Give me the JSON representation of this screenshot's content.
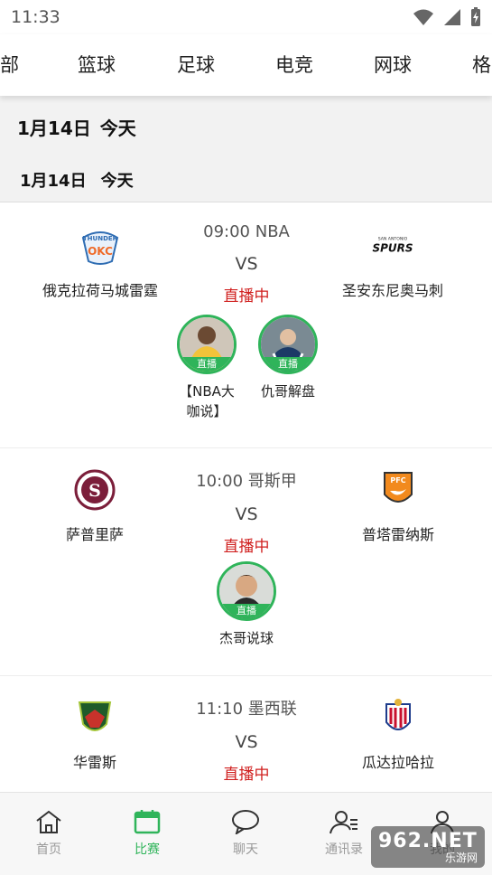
{
  "status_bar": {
    "time": "11:33"
  },
  "tabs": [
    "部",
    "篮球",
    "足球",
    "电竞",
    "网球",
    "格"
  ],
  "date_banner": {
    "date": "1月14日",
    "label": "今天"
  },
  "date_header": {
    "date": "1月14日",
    "label": "今天"
  },
  "matches": [
    {
      "time": "09:00",
      "league": "NBA",
      "vs": "VS",
      "status": "直播中",
      "home": {
        "name": "俄克拉荷马城雷霆",
        "logo": "thunder-logo"
      },
      "away": {
        "name": "圣安东尼奥马刺",
        "logo": "spurs-logo"
      },
      "streamers": [
        {
          "name_line1": "【NBA大",
          "name_line2": "咖说】",
          "badge": "直播"
        },
        {
          "name_line1": "仇哥解盘",
          "name_line2": "",
          "badge": "直播"
        }
      ]
    },
    {
      "time": "10:00",
      "league": "哥斯甲",
      "vs": "VS",
      "status": "直播中",
      "home": {
        "name": "萨普里萨",
        "logo": "saprissa-logo"
      },
      "away": {
        "name": "普塔雷纳斯",
        "logo": "puntarenas-logo"
      },
      "streamers": [
        {
          "name_line1": "杰哥说球",
          "name_line2": "",
          "badge": "直播"
        }
      ]
    },
    {
      "time": "11:10",
      "league": "墨西联",
      "vs": "VS",
      "status": "直播中",
      "home": {
        "name": "华雷斯",
        "logo": "juarez-logo"
      },
      "away": {
        "name": "瓜达拉哈拉",
        "logo": "chivas-logo"
      },
      "streamers": []
    }
  ],
  "bottom_nav": [
    {
      "label": "首页",
      "icon": "home-icon",
      "active": false
    },
    {
      "label": "比赛",
      "icon": "calendar-icon",
      "active": true
    },
    {
      "label": "聊天",
      "icon": "chat-icon",
      "active": false
    },
    {
      "label": "通讯录",
      "icon": "contacts-icon",
      "active": false
    },
    {
      "label": "我的",
      "icon": "profile-icon",
      "active": false
    }
  ],
  "watermark": {
    "top": "962.NET",
    "bottom": "乐游网"
  },
  "colors": {
    "accent": "#2fb45a",
    "live": "#d0201f",
    "banner_bg": "#f2f2f2"
  }
}
